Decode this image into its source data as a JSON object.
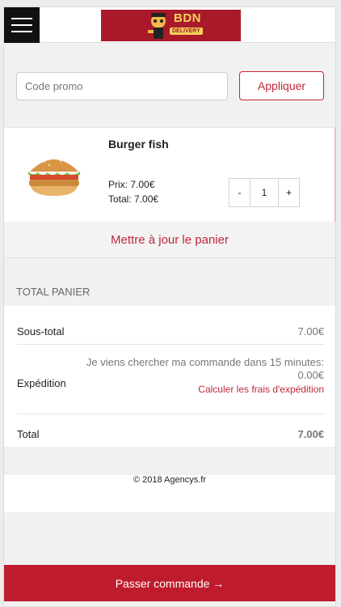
{
  "header": {
    "menu_icon": "hamburger-menu-icon",
    "logo": {
      "name": "BDN",
      "tagline": "DELIVERY",
      "bg": "#a81a2a",
      "text_color": "#f7d25a"
    }
  },
  "promo": {
    "placeholder": "Code promo",
    "apply_label": "Appliquer"
  },
  "cart": {
    "items": [
      {
        "name": "Burger fish",
        "image": "burger-image",
        "price": "Prix: 7.00€",
        "total": "Total: 7.00€",
        "quantity": "1",
        "minus_label": "-",
        "plus_label": "+"
      }
    ],
    "update_label": "Mettre à jour le panier"
  },
  "totals": {
    "title": "TOTAL PANIER",
    "subtotal_label": "Sous-total",
    "subtotal_value": "7.00€",
    "shipping_label": "Expédition",
    "shipping_note": "Je viens chercher ma commande dans 15 minutes: 0.00€",
    "shipping_link": "Calculer les frais d'expédition",
    "total_label": "Total",
    "total_value": "7.00€"
  },
  "footer": {
    "copyright": "© 2018 Agencys.fr"
  },
  "checkout": {
    "label": "Passer commande →"
  },
  "colors": {
    "accent": "#be1c2d",
    "background": "#f1f1f1"
  }
}
